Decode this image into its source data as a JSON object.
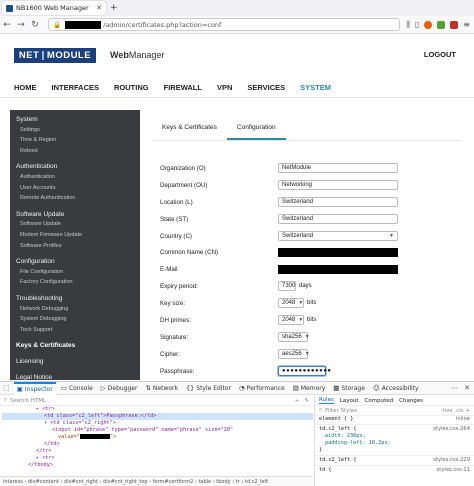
{
  "browser": {
    "tab_title": "NB1600 Web Manager",
    "url_prefix": "",
    "url_path": "/admin/certificates.php?action=conf"
  },
  "app": {
    "logo": "NETMODULE",
    "name_bold": "Web",
    "name_rest": "Manager",
    "logout": "LOGOUT"
  },
  "nav": [
    "HOME",
    "INTERFACES",
    "ROUTING",
    "FIREWALL",
    "VPN",
    "SERVICES",
    "SYSTEM"
  ],
  "sidebar": [
    {
      "label": "System",
      "type": "section"
    },
    {
      "label": "Settings",
      "type": "item"
    },
    {
      "label": "Time & Region",
      "type": "item"
    },
    {
      "label": "Reboot",
      "type": "item"
    },
    {
      "label": "Authentication",
      "type": "section"
    },
    {
      "label": "Authentication",
      "type": "item"
    },
    {
      "label": "User Accounts",
      "type": "item"
    },
    {
      "label": "Remote Authentication",
      "type": "item"
    },
    {
      "label": "Software Update",
      "type": "section"
    },
    {
      "label": "Software Update",
      "type": "item"
    },
    {
      "label": "Modem Firmware Update",
      "type": "item"
    },
    {
      "label": "Software Profiles",
      "type": "item"
    },
    {
      "label": "Configuration",
      "type": "section"
    },
    {
      "label": "File Configuration",
      "type": "item"
    },
    {
      "label": "Factory Configuration",
      "type": "item"
    },
    {
      "label": "Troubleshooting",
      "type": "section"
    },
    {
      "label": "Network Debugging",
      "type": "item"
    },
    {
      "label": "System Debugging",
      "type": "item"
    },
    {
      "label": "Tech Support",
      "type": "item"
    },
    {
      "label": "Keys & Certificates",
      "type": "active"
    },
    {
      "label": "Licensing",
      "type": "section"
    },
    {
      "label": "Legal Notice",
      "type": "section"
    }
  ],
  "tabs": {
    "keys": "Keys & Certificates",
    "config": "Configuration"
  },
  "form": {
    "org_label": "Organization (O)",
    "org_value": "NetModule",
    "dept_label": "Department (OU)",
    "dept_value": "Networking",
    "loc_label": "Location (L)",
    "loc_value": "Switzerland",
    "state_label": "State (ST)",
    "state_value": "Switzerland",
    "country_label": "Country (C)",
    "country_value": "Switzerland",
    "cn_label": "Common Name (CN)",
    "email_label": "E-Mail",
    "expiry_label": "Expiry period:",
    "expiry_value": "7300",
    "expiry_unit": "days",
    "keysize_label": "Key size:",
    "keysize_value": "2048",
    "keysize_unit": "bits",
    "dh_label": "DH primes:",
    "dh_value": "2048",
    "dh_unit": "bits",
    "sig_label": "Signature:",
    "sig_value": "sha256",
    "cipher_label": "Cipher:",
    "cipher_value": "aes256",
    "pass_label": "Passphrase:",
    "pass_value": "●●●●●●●●●●●●"
  },
  "devtools": {
    "tabs": [
      "Inspector",
      "Console",
      "Debugger",
      "Network",
      "Style Editor",
      "Performance",
      "Memory",
      "Storage",
      "Accessibility"
    ],
    "search_placeholder": "Search HTML",
    "code": [
      "▸ <tr>",
      "<td class=\"c2_left\">Passphrase:</td>",
      "▾ <td class=\"c2_right\">",
      "<input id=\"phrase\" type=\"password\" name=\"phrase\" size=\"20\"",
      "value=\"",
      "</td>",
      "</tr>",
      "▸ <tr>",
      "</tbody>"
    ],
    "breadcrumb": "intaress › div#content › div#cnt_right › div#cnt_right_top › form#certform2 › table › tbody › tr › td.c2_left",
    "right_tabs": [
      "Rules",
      "Layout",
      "Computed",
      "Changes"
    ],
    "filter_placeholder": "Filter Styles",
    "filter_toggles": ":hov  .cls  +",
    "rules": [
      {
        "selector": "element { }",
        "source": "inline"
      },
      {
        "selector": "td.c2_left {",
        "source": "styles.css:264",
        "props": [
          [
            "width",
            "236px;"
          ],
          [
            "padding-left",
            "10.2px;"
          ]
        ]
      },
      {
        "selector": "td.c2_left {",
        "source": "styles.css:229",
        "props": []
      },
      {
        "selector": "td {",
        "source": "styles.css:11",
        "props": []
      }
    ]
  }
}
